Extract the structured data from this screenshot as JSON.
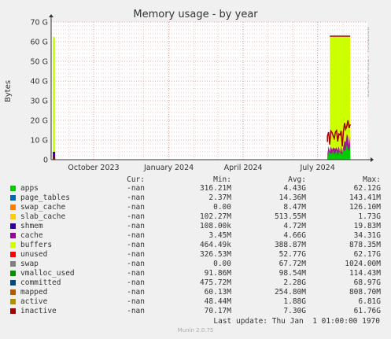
{
  "title": "Memory usage - by year",
  "side_label": "RRDTOOL / TOBI OETIKER",
  "footer": "Munin 2.0.75",
  "last_update": "Last update: Thu Jan  1 01:00:00 1970",
  "columns": {
    "cur": "Cur:",
    "min": "Min:",
    "avg": "Avg:",
    "max": "Max:"
  },
  "legend": [
    {
      "name": "apps",
      "color": "#00cc00",
      "cur": "-nan",
      "min": "316.21M",
      "avg": "4.43G",
      "max": "62.12G"
    },
    {
      "name": "page_tables",
      "color": "#0066b3",
      "cur": "-nan",
      "min": "2.37M",
      "avg": "14.36M",
      "max": "143.41M"
    },
    {
      "name": "swap_cache",
      "color": "#ff8000",
      "cur": "-nan",
      "min": "0.00",
      "avg": "8.47M",
      "max": "126.10M"
    },
    {
      "name": "slab_cache",
      "color": "#ffcc00",
      "cur": "-nan",
      "min": "102.27M",
      "avg": "513.55M",
      "max": "1.73G"
    },
    {
      "name": "shmem",
      "color": "#330099",
      "cur": "-nan",
      "min": "108.00k",
      "avg": "4.72M",
      "max": "19.83M"
    },
    {
      "name": "cache",
      "color": "#990099",
      "cur": "-nan",
      "min": "3.45M",
      "avg": "4.66G",
      "max": "34.31G"
    },
    {
      "name": "buffers",
      "color": "#ccff00",
      "cur": "-nan",
      "min": "464.49k",
      "avg": "388.87M",
      "max": "878.35M"
    },
    {
      "name": "unused",
      "color": "#ff0000",
      "cur": "-nan",
      "min": "326.53M",
      "avg": "52.77G",
      "max": "62.17G"
    },
    {
      "name": "swap",
      "color": "#808080",
      "cur": "-nan",
      "min": "0.00",
      "avg": "67.72M",
      "max": "1024.00M"
    },
    {
      "name": "vmalloc_used",
      "color": "#008f00",
      "cur": "-nan",
      "min": "91.86M",
      "avg": "98.54M",
      "max": "114.43M"
    },
    {
      "name": "committed",
      "color": "#00487d",
      "cur": "-nan",
      "min": "475.72M",
      "avg": "2.28G",
      "max": "68.97G"
    },
    {
      "name": "mapped",
      "color": "#b35a00",
      "cur": "-nan",
      "min": "60.13M",
      "avg": "254.80M",
      "max": "808.70M"
    },
    {
      "name": "active",
      "color": "#b38f00",
      "cur": "-nan",
      "min": "48.44M",
      "avg": "1.88G",
      "max": "6.81G"
    },
    {
      "name": "inactive",
      "color": "#a10000",
      "cur": "-nan",
      "min": "70.17M",
      "avg": "7.30G",
      "max": "61.76G"
    }
  ],
  "chart_data": {
    "type": "area",
    "title": "Memory usage - by year",
    "ylabel": "Bytes",
    "ylim": [
      0,
      70
    ],
    "yunit": "G",
    "yticks": [
      "0",
      "10 G",
      "20 G",
      "30 G",
      "40 G",
      "50 G",
      "60 G",
      "70 G"
    ],
    "xticks": [
      "October 2023",
      "January 2024",
      "April 2024",
      "July 2024"
    ],
    "series": [
      {
        "name": "unused",
        "color": "#ccff00",
        "x": [
          "2023-08",
          "2024-07"
        ],
        "values": [
          62.5,
          62.5
        ]
      },
      {
        "name": "apps",
        "color": "#00cc00",
        "x": [
          "2024-07"
        ],
        "values": [
          4.0
        ]
      },
      {
        "name": "cache",
        "color": "#330099",
        "x": [
          "2023-08",
          "2024-07"
        ],
        "values": [
          4.0,
          6.0
        ]
      },
      {
        "name": "committed",
        "color": "#a10000",
        "x": [
          "2024-07"
        ],
        "values": [
          19.0
        ]
      }
    ],
    "grid": true
  }
}
